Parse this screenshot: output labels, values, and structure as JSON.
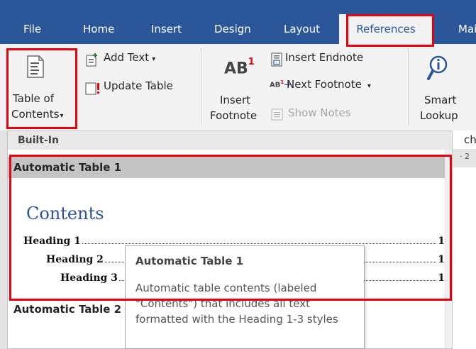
{
  "tabs": {
    "file": "File",
    "home": "Home",
    "insert": "Insert",
    "design": "Design",
    "layout": "Layout",
    "references": "References",
    "mailings": "Mail"
  },
  "ribbon": {
    "toc": {
      "line1": "Table of",
      "line2": "Contents",
      "arrow": "▾"
    },
    "add_text": "Add Text",
    "add_text_arrow": "▾",
    "update_table": "Update Table",
    "insert_footnote": {
      "glyph": "AB",
      "sup": "1",
      "line1": "Insert",
      "line2": "Footnote"
    },
    "insert_endnote": "Insert Endnote",
    "next_footnote": "Next Footnote",
    "next_footnote_arrow": "▾",
    "show_notes": "Show Notes",
    "smart_lookup": {
      "line1": "Smart",
      "line2": "Lookup",
      "partial": "ch"
    }
  },
  "ruler_partial": "· 2",
  "gallery": {
    "section_header": "Built-In",
    "item1": {
      "label": "Automatic Table 1",
      "preview": {
        "title": "Contents",
        "entries": [
          {
            "text": "Heading 1",
            "page": "1"
          },
          {
            "text": "Heading 2",
            "page": "1"
          },
          {
            "text": "Heading 3",
            "page": "1"
          }
        ]
      }
    },
    "item2": {
      "label": "Automatic Table 2"
    }
  },
  "tooltip": {
    "title": "Automatic Table 1",
    "body": "Automatic table contents (labeled \"Contents\") that includes all text formatted with the Heading 1-3 styles"
  },
  "colors": {
    "titlebar": "#2b579a",
    "ribbon_bg": "#f3f3f3",
    "highlight": "#e8000b",
    "toc_title": "#2f5496",
    "item_head_bg": "#c4c4c4"
  },
  "icons": [
    "toc-icon",
    "add-text-icon",
    "update-table-icon",
    "insert-endnote-icon",
    "next-footnote-icon",
    "show-notes-icon",
    "smart-lookup-icon"
  ]
}
